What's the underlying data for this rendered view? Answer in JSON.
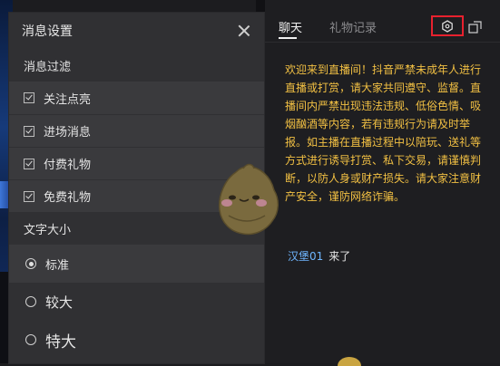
{
  "settings_panel": {
    "title": "消息设置",
    "filter_section_label": "消息过滤",
    "filters": [
      {
        "label": "关注点亮",
        "checked": true
      },
      {
        "label": "进场消息",
        "checked": true
      },
      {
        "label": "付费礼物",
        "checked": true
      },
      {
        "label": "免费礼物",
        "checked": true
      }
    ],
    "font_section_label": "文字大小",
    "font_sizes": [
      {
        "label": "标准",
        "selected": true
      },
      {
        "label": "较大",
        "selected": false
      },
      {
        "label": "特大",
        "selected": false
      }
    ]
  },
  "chat": {
    "tabs": [
      {
        "label": "聊天",
        "active": true
      },
      {
        "label": "礼物记录",
        "active": false
      }
    ],
    "notice": "欢迎来到直播间！抖音严禁未成年人进行直播或打赏，请大家共同遵守、监督。直播间内严禁出现违法违规、低俗色情、吸烟酗酒等内容，若有违规行为请及时举报。如主播在直播过程中以陪玩、送礼等方式进行诱导打赏、私下交易，请谨慎判断，以防人身或财产损失。请大家注意财产安全，谨防网络诈骗。",
    "message": {
      "user": "汉堡01",
      "text": "来了"
    }
  },
  "icons": {
    "settings": "settings-hexagon-icon",
    "popout": "popout-window-icon",
    "close": "close-icon"
  },
  "colors": {
    "notice_text": "#f2c043",
    "username": "#6fb6ff",
    "highlight_box": "#e8212e"
  }
}
